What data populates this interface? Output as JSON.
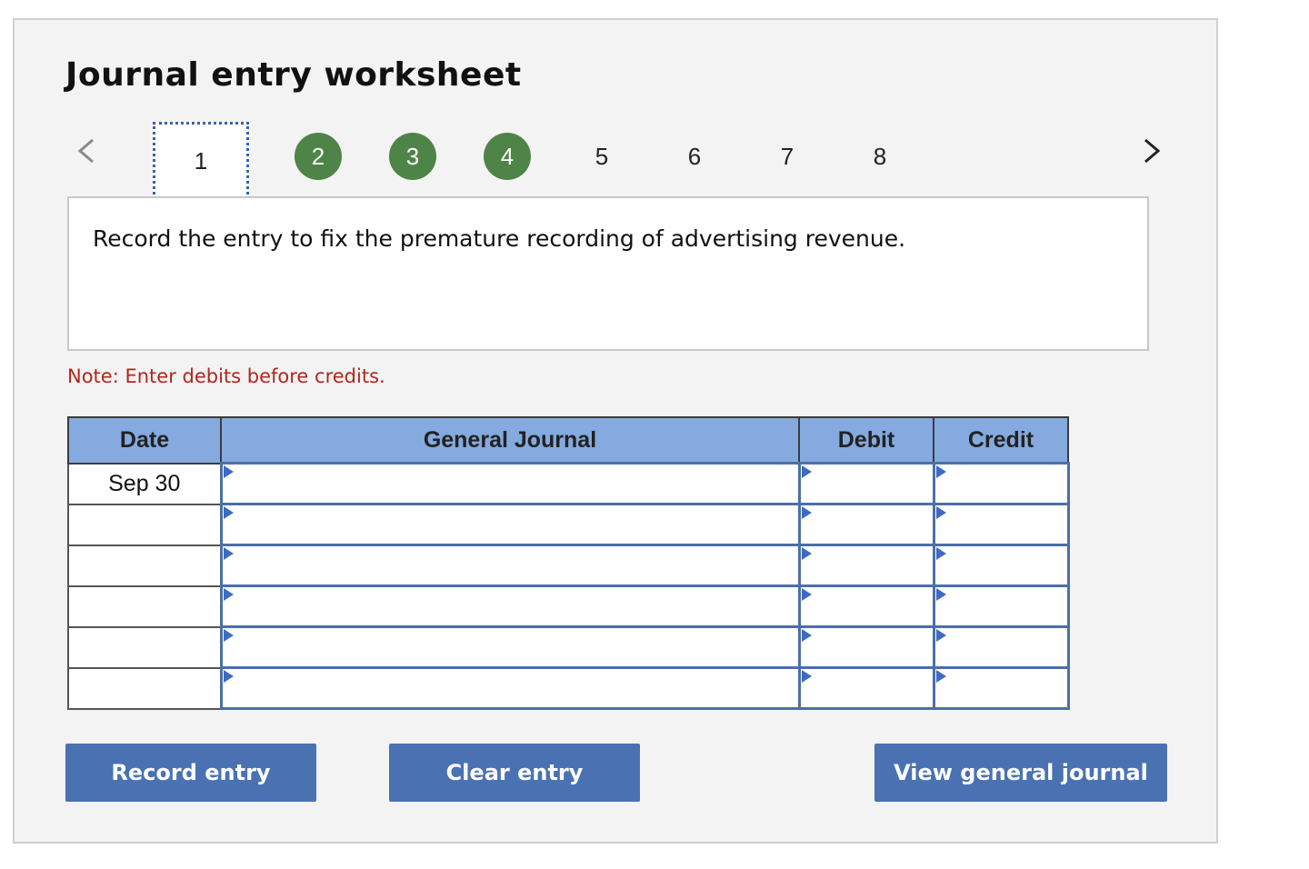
{
  "title": "Journal entry worksheet",
  "steps": [
    {
      "label": "1",
      "state": "current"
    },
    {
      "label": "2",
      "state": "done"
    },
    {
      "label": "3",
      "state": "done"
    },
    {
      "label": "4",
      "state": "done"
    },
    {
      "label": "5",
      "state": "pending"
    },
    {
      "label": "6",
      "state": "pending"
    },
    {
      "label": "7",
      "state": "pending"
    },
    {
      "label": "8",
      "state": "pending"
    }
  ],
  "prompt": "Record the entry to fix the premature recording of advertising revenue.",
  "note": "Note: Enter debits before credits.",
  "table": {
    "headers": {
      "date": "Date",
      "journal": "General Journal",
      "debit": "Debit",
      "credit": "Credit"
    },
    "rows": [
      {
        "date": "Sep 30"
      },
      {
        "date": ""
      },
      {
        "date": ""
      },
      {
        "date": ""
      },
      {
        "date": ""
      },
      {
        "date": ""
      }
    ]
  },
  "buttons": {
    "record": "Record entry",
    "clear": "Clear entry",
    "view": "View general journal"
  },
  "colors": {
    "done_step": "#4e8447",
    "header_fill": "#84aadf",
    "button": "#4a72b2",
    "note": "#b3261e"
  }
}
